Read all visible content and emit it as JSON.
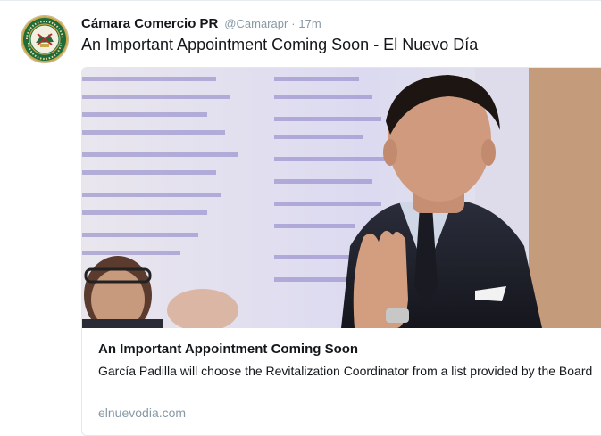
{
  "tweet": {
    "author_name": "Cámara Comercio PR",
    "author_handle": "@Camarapr",
    "separator": "·",
    "time": "17m",
    "text": "An Important Appointment Coming Soon - El Nuevo Día",
    "avatar_icon": "chamber-of-commerce-seal-icon",
    "card": {
      "title": "An Important Appointment Coming Soon",
      "description": "García Padilla will choose the Revitalization Coordinator from a list provided by the Board",
      "domain": "elnuevodia.com",
      "image": "photo-man-in-suit-gesturing-before-projected-slide"
    }
  },
  "colors": {
    "text_primary": "#14171a",
    "text_secondary": "#8899a6",
    "border": "#e1e8ed",
    "seal_green": "#1f6b3a",
    "seal_gold": "#c9a84c"
  }
}
